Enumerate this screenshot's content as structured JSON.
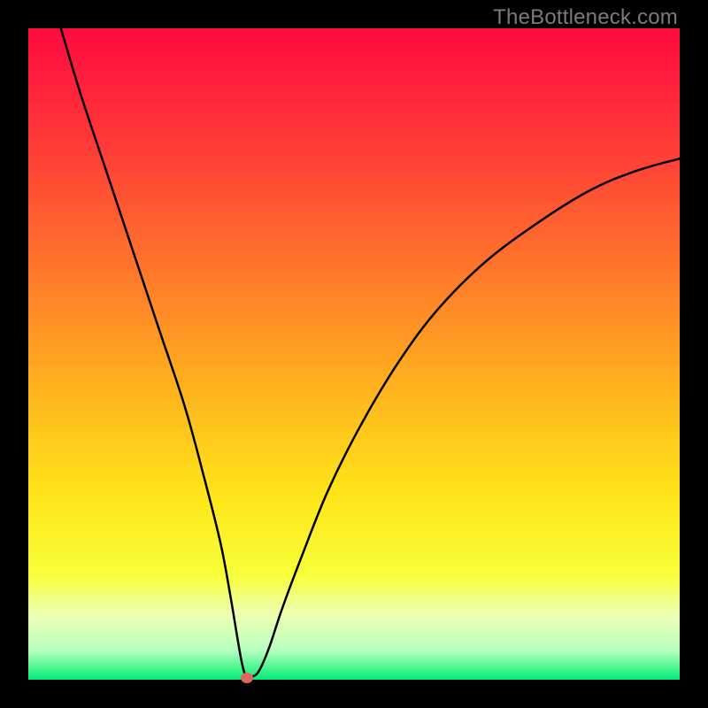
{
  "watermark": {
    "text": "TheBottleneck.com"
  },
  "chart_data": {
    "type": "line",
    "title": "",
    "xlabel": "",
    "ylabel": "",
    "xlim": [
      0,
      100
    ],
    "ylim": [
      0,
      100
    ],
    "grid": false,
    "legend": false,
    "background": {
      "type": "vertical-gradient",
      "stops": [
        {
          "pos": 0.0,
          "color": "#ff0a3f"
        },
        {
          "pos": 0.18,
          "color": "#ff3b38"
        },
        {
          "pos": 0.38,
          "color": "#ff7a2b"
        },
        {
          "pos": 0.55,
          "color": "#ffb21e"
        },
        {
          "pos": 0.72,
          "color": "#ffe61a"
        },
        {
          "pos": 0.84,
          "color": "#f7ff3a"
        },
        {
          "pos": 0.9,
          "color": "#eeffb4"
        },
        {
          "pos": 0.955,
          "color": "#b8ffc0"
        },
        {
          "pos": 0.985,
          "color": "#3ef58a"
        },
        {
          "pos": 1.0,
          "color": "#00ea7a"
        }
      ]
    },
    "series": [
      {
        "name": "bottleneck-curve",
        "color": "#000000",
        "x": [
          5,
          8,
          12,
          16,
          20,
          24,
          27,
          29.5,
          31,
          32,
          32.7,
          33.2,
          33.7,
          34.5,
          35.5,
          37,
          39,
          42,
          46,
          51,
          57,
          63,
          70,
          78,
          86,
          93,
          100
        ],
        "y": [
          100,
          90,
          78,
          66,
          54,
          42,
          31,
          21,
          13,
          7,
          3,
          1,
          0.5,
          0.5,
          1.5,
          5,
          11,
          19,
          29,
          39,
          49,
          57,
          64,
          70,
          75,
          78,
          80
        ]
      }
    ],
    "marker": {
      "x": 33.5,
      "y": 0.3,
      "color": "#da6b5b"
    }
  }
}
